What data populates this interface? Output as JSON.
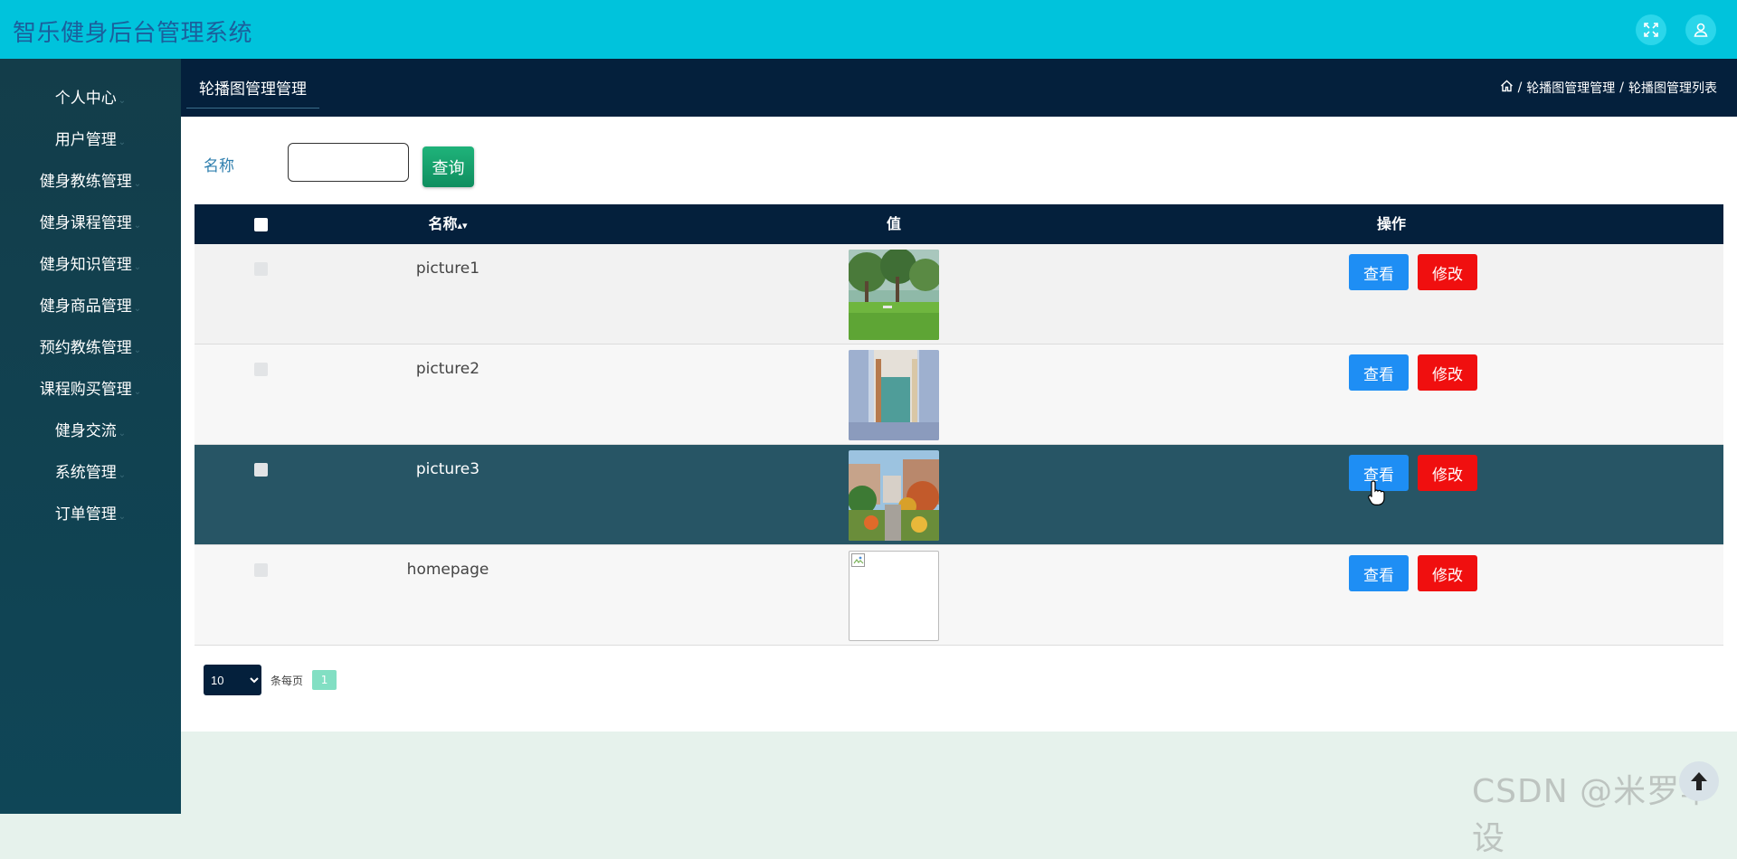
{
  "app": {
    "title": "智乐健身后台管理系统",
    "accent_color": "#00c3dc",
    "header_color": "#04203c",
    "icons": [
      "fullscreen-icon",
      "user-icon"
    ]
  },
  "sidebar": {
    "items": [
      {
        "label": "个人中心"
      },
      {
        "label": "用户管理"
      },
      {
        "label": "健身教练管理"
      },
      {
        "label": "健身课程管理"
      },
      {
        "label": "健身知识管理"
      },
      {
        "label": "健身商品管理"
      },
      {
        "label": "预约教练管理"
      },
      {
        "label": "课程购买管理"
      },
      {
        "label": "健身交流"
      },
      {
        "label": "系统管理"
      },
      {
        "label": "订单管理"
      }
    ]
  },
  "header": {
    "tab": "轮播图管理管理",
    "breadcrumb": {
      "separator": "/",
      "items": [
        "轮播图管理管理",
        "轮播图管理列表"
      ]
    }
  },
  "search": {
    "label": "名称",
    "value": "",
    "placeholder": "",
    "button": "查询"
  },
  "table": {
    "columns": {
      "name": "名称",
      "sort_icon": "sort-icon",
      "value": "值",
      "actions": "操作"
    },
    "rows": [
      {
        "name": "picture1",
        "image": "campus-lawn-photo",
        "view": "查看",
        "edit": "修改"
      },
      {
        "name": "picture2",
        "image": "window-interior-photo",
        "view": "查看",
        "edit": "修改"
      },
      {
        "name": "picture3",
        "image": "campus-garden-photo",
        "view": "查看",
        "edit": "修改",
        "highlighted": true
      },
      {
        "name": "homepage",
        "image": "broken-image",
        "view": "查看",
        "edit": "修改"
      }
    ]
  },
  "pagination": {
    "page_size": "10",
    "per_page_label": "条每页",
    "current_page": "1"
  },
  "watermark": "CSDN @米罗毕设"
}
